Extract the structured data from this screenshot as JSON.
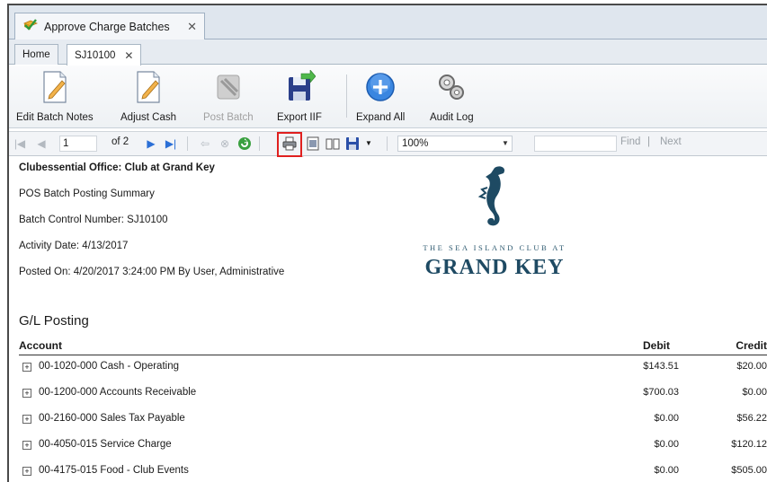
{
  "window": {
    "doc_tab_title": "Approve Charge Batches",
    "close_glyph": "✕"
  },
  "tabs": {
    "home": "Home",
    "batch": "SJ10100",
    "close_glyph": "✕"
  },
  "ribbon": {
    "edit_batch_notes": "Edit Batch Notes",
    "adjust_cash": "Adjust Cash",
    "post_batch": "Post Batch",
    "export_iif": "Export IIF",
    "expand_all": "Expand All",
    "audit_log": "Audit Log"
  },
  "report_toolbar": {
    "page_value": "1",
    "of_pages": "of 2",
    "zoom": "100%",
    "find_label": "Find",
    "separator": "|",
    "next_label": "Next"
  },
  "report": {
    "office": "Clubessential Office: Club at Grand Key",
    "summary_title": "POS Batch Posting Summary",
    "batch_control": "Batch Control Number: SJ10100",
    "activity_date": "Activity Date: 4/13/2017",
    "posted_on": "Posted On: 4/20/2017 3:24:00 PM By User, Administrative",
    "logo_sub": "THE SEA ISLAND CLUB AT",
    "logo_main": "GRAND KEY",
    "section_title": "G/L Posting",
    "columns": {
      "account": "Account",
      "debit": "Debit",
      "credit": "Credit"
    },
    "rows": [
      {
        "account": "00-1020-000 Cash - Operating",
        "debit": "$143.51",
        "credit": "$20.00"
      },
      {
        "account": "00-1200-000 Accounts Receivable",
        "debit": "$700.03",
        "credit": "$0.00"
      },
      {
        "account": "00-2160-000 Sales Tax Payable",
        "debit": "$0.00",
        "credit": "$56.22"
      },
      {
        "account": "00-4050-015 Service Charge",
        "debit": "$0.00",
        "credit": "$120.12"
      },
      {
        "account": "00-4175-015 Food - Club Events",
        "debit": "$0.00",
        "credit": "$505.00"
      }
    ]
  },
  "colors": {
    "highlight": "#e0201f",
    "accent_blue": "#2b6fd6",
    "logo": "#1e4a63"
  }
}
